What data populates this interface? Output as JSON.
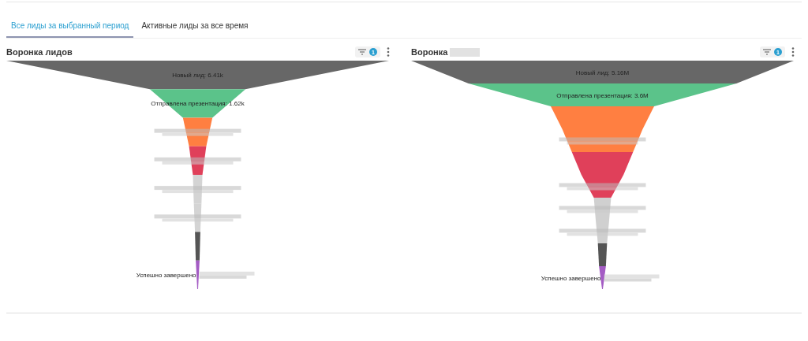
{
  "tabs": [
    {
      "label": "Все лиды за выбранный период",
      "selected": true
    },
    {
      "label": "Активные лиды за все время",
      "selected": false
    }
  ],
  "panels": [
    {
      "title": "Воронка лидов",
      "title_redacted": false,
      "filter_badge": "1",
      "stages": [
        {
          "kind": "labeled",
          "label": "Новый лид: 6.41k",
          "color": "#676767"
        },
        {
          "kind": "labeled",
          "label": "Отправлена презентация: 1.62k",
          "color": "#5bc38a"
        },
        {
          "kind": "redacted",
          "color": "#ff7f41"
        },
        {
          "kind": "redacted",
          "color": "#e0405a"
        },
        {
          "kind": "redacted",
          "color": "#d4d4d4"
        },
        {
          "kind": "redacted",
          "color": "#d4d4d4"
        },
        {
          "kind": "plain",
          "color": "#555555"
        },
        {
          "kind": "partial",
          "label": "Успешно завершено",
          "color": "#a45cc4"
        }
      ]
    },
    {
      "title": "Воронка",
      "title_redacted": true,
      "filter_badge": "1",
      "stages": [
        {
          "kind": "labeled",
          "label": "Новый лид: 5.16M",
          "color": "#676767"
        },
        {
          "kind": "labeled",
          "label": "Отправлена презентация: 3.6M",
          "color": "#5bc38a"
        },
        {
          "kind": "plain",
          "color": "#ff7f41"
        },
        {
          "kind": "redacted",
          "color": "#ff7f41"
        },
        {
          "kind": "plain",
          "color": "#e0405a"
        },
        {
          "kind": "redacted",
          "color": "#e0405a"
        },
        {
          "kind": "redacted",
          "color": "#d0d0d0"
        },
        {
          "kind": "redacted",
          "color": "#d0d0d0"
        },
        {
          "kind": "plain",
          "color": "#555555"
        },
        {
          "kind": "partial",
          "label": "Успешно завершено",
          "color": "#a45cc4"
        }
      ]
    }
  ]
}
